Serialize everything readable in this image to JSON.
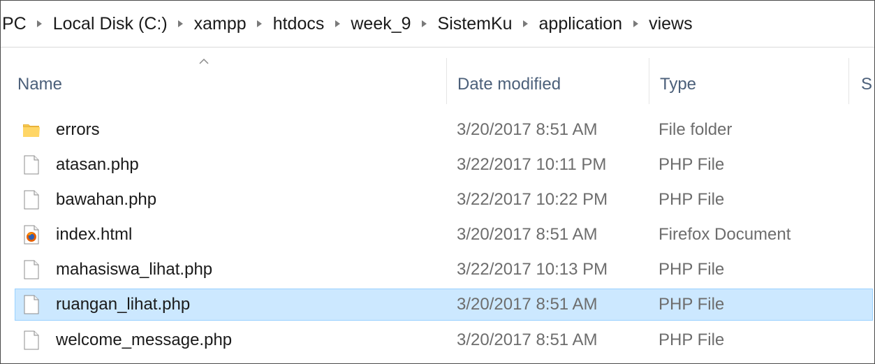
{
  "breadcrumb": {
    "items": [
      "PC",
      "Local Disk (C:)",
      "xampp",
      "htdocs",
      "week_9",
      "SistemKu",
      "application",
      "views"
    ]
  },
  "columns": {
    "name": "Name",
    "date_modified": "Date modified",
    "type": "Type",
    "size_partial": "S"
  },
  "files": [
    {
      "name": "errors",
      "date": "3/20/2017 8:51 AM",
      "type": "File folder",
      "icon": "folder-icon"
    },
    {
      "name": "atasan.php",
      "date": "3/22/2017 10:11 PM",
      "type": "PHP File",
      "icon": "document-icon"
    },
    {
      "name": "bawahan.php",
      "date": "3/22/2017 10:22 PM",
      "type": "PHP File",
      "icon": "document-icon"
    },
    {
      "name": "index.html",
      "date": "3/20/2017 8:51 AM",
      "type": "Firefox Document",
      "icon": "firefox-icon"
    },
    {
      "name": "mahasiswa_lihat.php",
      "date": "3/22/2017 10:13 PM",
      "type": "PHP File",
      "icon": "document-icon"
    },
    {
      "name": "ruangan_lihat.php",
      "date": "3/20/2017 8:51 AM",
      "type": "PHP File",
      "icon": "document-icon",
      "selected": true
    },
    {
      "name": "welcome_message.php",
      "date": "3/20/2017 8:51 AM",
      "type": "PHP File",
      "icon": "document-icon"
    }
  ],
  "colors": {
    "selection_bg": "#cce8ff",
    "selection_border": "#99d1ff",
    "header_text": "#4c607a",
    "secondary_text": "#6d6d6d"
  }
}
